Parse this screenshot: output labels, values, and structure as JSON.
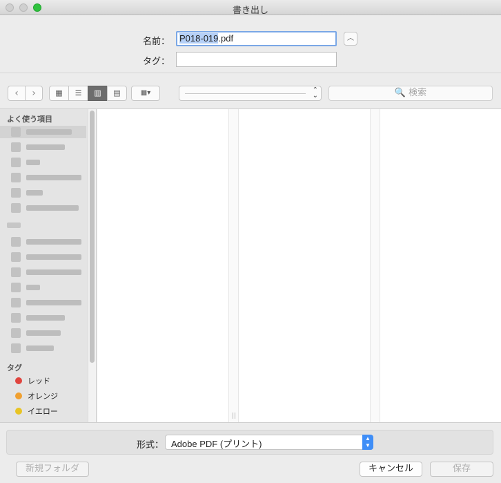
{
  "window": {
    "title": "書き出し"
  },
  "form": {
    "name_label": "名前：",
    "name_value_selected": "P018-019",
    "name_value_ext": ".pdf",
    "tag_label": "タグ：",
    "tag_value": ""
  },
  "toolbar": {
    "back_icon": "‹",
    "forward_icon": "›",
    "view_icon_glyph": "▦",
    "view_list_glyph": "☰",
    "view_column_glyph": "▥",
    "view_coverflow_glyph": "▤",
    "arrange_glyph": "▦▾",
    "path_popup_arrows": "⌃⌄",
    "search_placeholder": "🔍 検索"
  },
  "sidebar": {
    "favorites_header": "よく使う項目",
    "devices_header": "",
    "tags_header": "タグ",
    "tags": [
      {
        "label": "レッド",
        "color": "#e0443e"
      },
      {
        "label": "オレンジ",
        "color": "#f0a030"
      },
      {
        "label": "イエロー",
        "color": "#e8c424"
      }
    ]
  },
  "footer": {
    "format_label": "形式：",
    "format_value": "Adobe PDF (プリント)",
    "new_folder_label": "新規フォルダ",
    "cancel_label": "キャンセル",
    "save_label": "保存"
  },
  "colors": {
    "accent": "#3f8ef7",
    "selection": "#b5d0f7",
    "zoom_button": "#2fc23e"
  }
}
